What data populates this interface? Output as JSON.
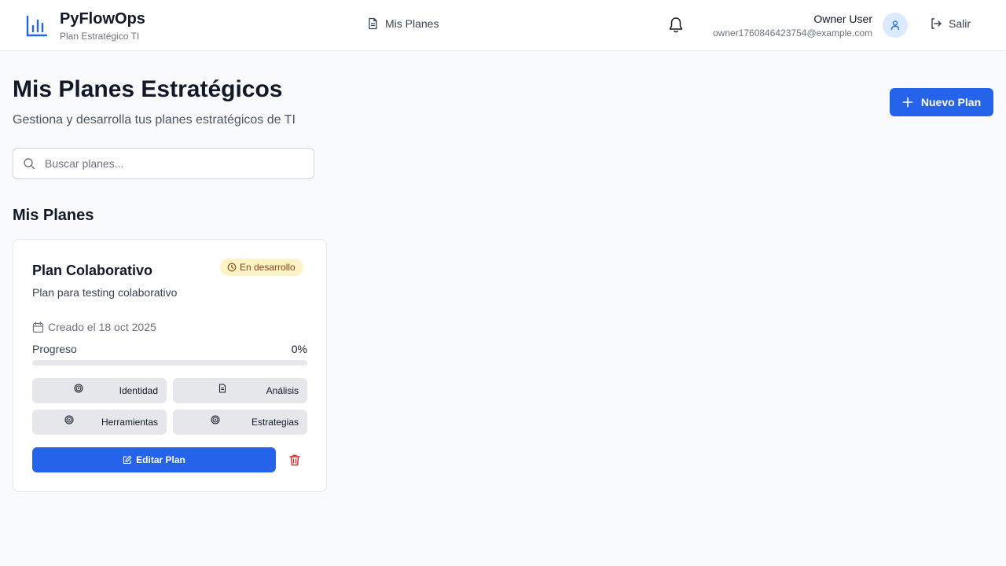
{
  "brand": {
    "name": "PyFlowOps",
    "subtitle": "Plan Estratégico TI",
    "icon": "bar-chart-icon",
    "color": "#2563eb"
  },
  "nav": {
    "plans_label": "Mis Planes",
    "plans_icon": "document-icon"
  },
  "user": {
    "name": "Owner User",
    "email": "owner1760846423754@example.com",
    "avatar_icon": "user-icon",
    "notifications_icon": "bell-icon",
    "logout_label": "Salir",
    "logout_icon": "logout-icon"
  },
  "page": {
    "title": "Mis Planes Estratégicos",
    "subtitle": "Gestiona y desarrolla tus planes estratégicos de TI",
    "new_plan_label": "Nuevo Plan",
    "search_placeholder": "Buscar planes...",
    "section_title": "Mis Planes"
  },
  "plans": [
    {
      "title": "Plan Colaborativo",
      "status": "En desarrollo",
      "description": "Plan para testing colaborativo",
      "created": "Creado el 18 oct 2025",
      "progress_label": "Progreso",
      "progress_value": "0%",
      "progress_fraction": 0,
      "modules": [
        {
          "label": "Identidad",
          "icon": "target-icon"
        },
        {
          "label": "Análisis",
          "icon": "document-icon"
        },
        {
          "label": "Herramientas",
          "icon": "target-icon"
        },
        {
          "label": "Estrategias",
          "icon": "target-icon"
        }
      ],
      "edit_label": "Editar Plan",
      "delete_icon": "trash-icon"
    }
  ],
  "colors": {
    "primary": "#2563eb",
    "badge_bg": "#fef3c7",
    "badge_text": "#92400e",
    "danger": "#dc2626"
  }
}
